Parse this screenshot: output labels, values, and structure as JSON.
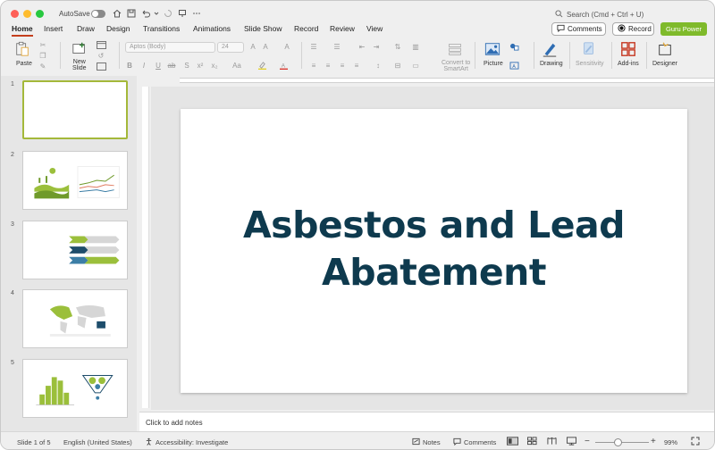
{
  "titlebar": {
    "autosave_label": "AutoSave",
    "search_placeholder": "Search (Cmd + Ctrl + U)"
  },
  "tabs": [
    {
      "label": "Home",
      "active": true
    },
    {
      "label": "Insert"
    },
    {
      "label": "Draw"
    },
    {
      "label": "Design"
    },
    {
      "label": "Transitions"
    },
    {
      "label": "Animations"
    },
    {
      "label": "Slide Show"
    },
    {
      "label": "Record"
    },
    {
      "label": "Review"
    },
    {
      "label": "View"
    }
  ],
  "actions": {
    "comments_label": "Comments",
    "record_label": "Record",
    "guru_label": "Guru Power",
    "guru_color": "#7fba2b"
  },
  "ribbon": {
    "paste_label": "Paste",
    "new_slide_label": "New\nSlide",
    "font_name": "Aptos (Body)",
    "font_size": "24",
    "convert_smartart_label": "Convert to\nSmartArt",
    "picture_label": "Picture",
    "drawing_label": "Drawing",
    "sensitivity_label": "Sensitivity",
    "addins_label": "Add-ins",
    "designer_label": "Designer"
  },
  "thumbnails": [
    {
      "number": "1",
      "selected": true
    },
    {
      "number": "2"
    },
    {
      "number": "3"
    },
    {
      "number": "4"
    },
    {
      "number": "5"
    }
  ],
  "slide": {
    "title_line1": "Asbestos and Lead",
    "title_line2": "Abatement",
    "title_color": "#0e3a4e"
  },
  "notes": {
    "placeholder": "Click to add notes"
  },
  "statusbar": {
    "slide_counter": "Slide 1 of 5",
    "language": "English (United States)",
    "accessibility": "Accessibility: Investigate",
    "notes_label": "Notes",
    "comments_label": "Comments",
    "zoom": "99%"
  },
  "colors": {
    "accent_tab": "#c43e1c",
    "thumb_selected": "#a4b83a"
  }
}
